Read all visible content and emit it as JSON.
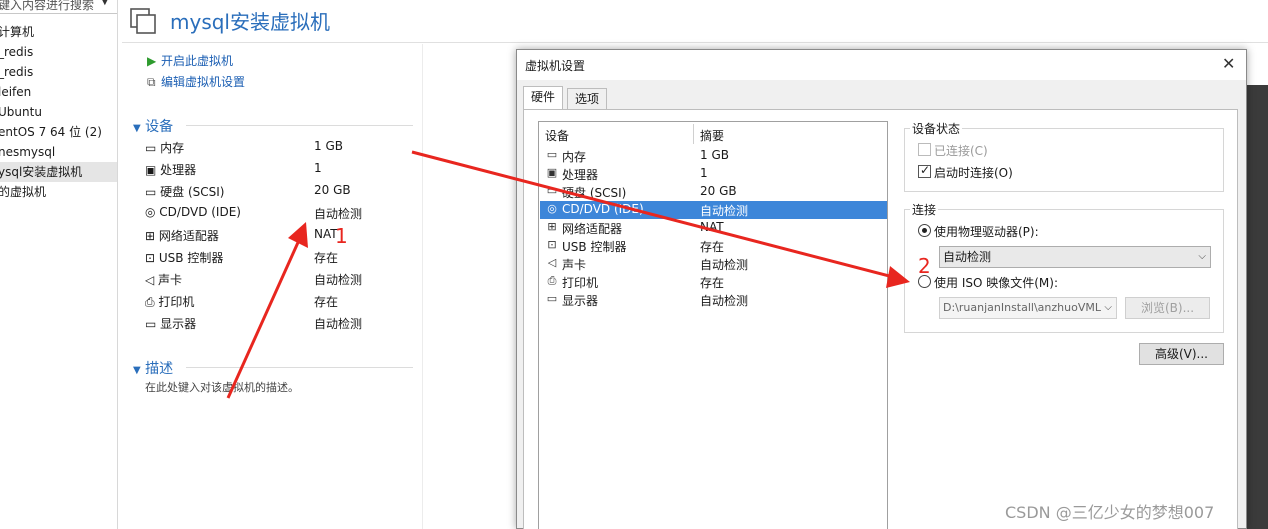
{
  "library": {
    "search_placeholder": "键入内容进行搜索",
    "items": [
      "计算机",
      "_redis",
      "_redis",
      "leifen",
      "Ubuntu",
      "entOS 7 64 位 (2)",
      "nesmysql",
      "ysql安装虚拟机",
      "的虚拟机"
    ]
  },
  "vm": {
    "title": "mysql安装虚拟机",
    "actions": {
      "power_on": "开启此虚拟机",
      "edit_settings": "编辑虚拟机设置"
    },
    "devices_heading": "设备",
    "devices": [
      {
        "name": "内存",
        "value": "1 GB",
        "icon": "memory-icon"
      },
      {
        "name": "处理器",
        "value": "1",
        "icon": "cpu-icon"
      },
      {
        "name": "硬盘 (SCSI)",
        "value": "20 GB",
        "icon": "harddisk-icon"
      },
      {
        "name": "CD/DVD (IDE)",
        "value": "自动检测",
        "icon": "cd-icon"
      },
      {
        "name": "网络适配器",
        "value": "NAT",
        "icon": "network-icon"
      },
      {
        "name": "USB 控制器",
        "value": "存在",
        "icon": "usb-icon"
      },
      {
        "name": "声卡",
        "value": "自动检测",
        "icon": "speaker-icon"
      },
      {
        "name": "打印机",
        "value": "存在",
        "icon": "printer-icon"
      },
      {
        "name": "显示器",
        "value": "自动检测",
        "icon": "monitor-icon"
      }
    ],
    "description_heading": "描述",
    "description_placeholder": "在此处键入对该虚拟机的描述。"
  },
  "dialog": {
    "title": "虚拟机设置",
    "tabs": [
      "硬件",
      "选项"
    ],
    "list_headers": {
      "name": "设备",
      "summary": "摘要"
    },
    "hardware": [
      {
        "name": "内存",
        "summary": "1 GB"
      },
      {
        "name": "处理器",
        "summary": "1"
      },
      {
        "name": "硬盘 (SCSI)",
        "summary": "20 GB"
      },
      {
        "name": "CD/DVD (IDE)",
        "summary": "自动检测"
      },
      {
        "name": "网络适配器",
        "summary": "NAT"
      },
      {
        "name": "USB 控制器",
        "summary": "存在"
      },
      {
        "name": "声卡",
        "summary": "自动检测"
      },
      {
        "name": "打印机",
        "summary": "存在"
      },
      {
        "name": "显示器",
        "summary": "自动检测"
      }
    ],
    "selected_index": 3,
    "device_status": {
      "heading": "设备状态",
      "connected": "已连接(C)",
      "connect_at_power_on": "启动时连接(O)",
      "connected_checked": false,
      "connect_at_power_on_checked": true
    },
    "connection": {
      "heading": "连接",
      "use_physical": "使用物理驱动器(P):",
      "physical_value": "自动检测",
      "use_iso": "使用 ISO 映像文件(M):",
      "iso_path": "D:\\ruanjanInstall\\anzhuoVML",
      "browse": "浏览(B)...",
      "selected": "physical"
    },
    "advanced": "高级(V)..."
  },
  "annotations": {
    "label_1": "1",
    "label_2": "2",
    "color": "#e8261f"
  },
  "watermark": "CSDN @三亿少女的梦想007"
}
